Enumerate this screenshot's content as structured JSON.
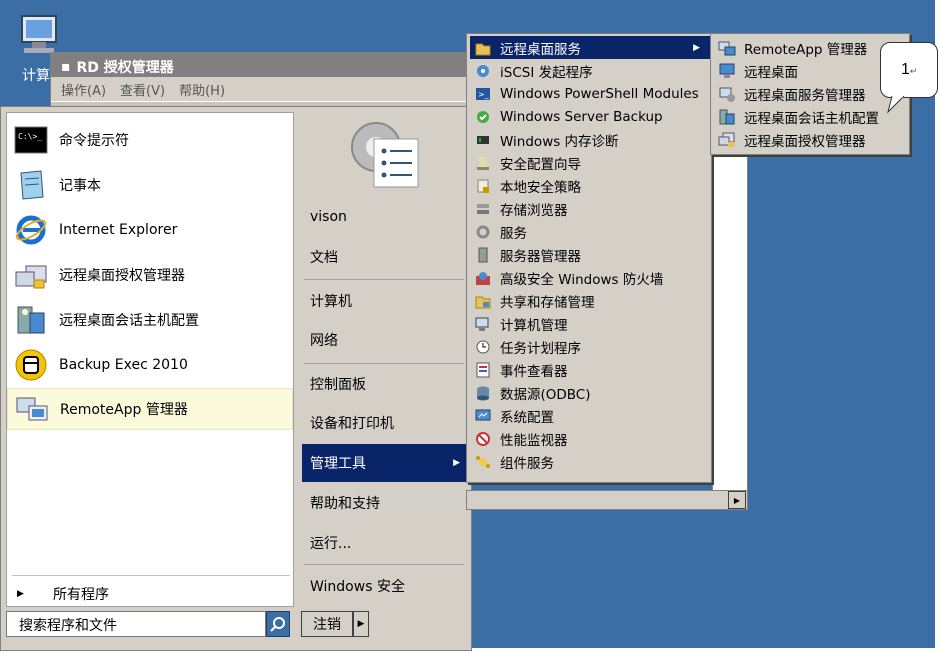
{
  "desktop": {
    "icon_label": "计算"
  },
  "background_window": {
    "title": "RD 授权管理器",
    "menu": [
      "操作(A)",
      "查看(V)",
      "帮助(H)"
    ]
  },
  "start_menu": {
    "pinned": [
      {
        "label": "命令提示符",
        "icon": "cmd-icon"
      },
      {
        "label": "记事本",
        "icon": "notepad-icon"
      },
      {
        "label": "Internet Explorer",
        "icon": "ie-icon"
      },
      {
        "label": "远程桌面授权管理器",
        "icon": "rd-license-icon"
      },
      {
        "label": "远程桌面会话主机配置",
        "icon": "rd-session-config-icon"
      },
      {
        "label": "Backup Exec 2010",
        "icon": "backup-exec-icon"
      },
      {
        "label": "RemoteApp 管理器",
        "icon": "remoteapp-icon"
      }
    ],
    "all_programs": "所有程序",
    "search_placeholder": "搜索程序和文件",
    "right": {
      "user": "vison",
      "items": [
        "文档",
        "计算机",
        "网络",
        "控制面板",
        "设备和打印机",
        "管理工具",
        "帮助和支持",
        "运行...",
        "Windows 安全"
      ]
    },
    "logout": "注销"
  },
  "admin_tools_menu": {
    "items": [
      {
        "label": "远程桌面服务",
        "has_submenu": true
      },
      {
        "label": "iSCSI 发起程序"
      },
      {
        "label": "Windows PowerShell Modules"
      },
      {
        "label": "Windows Server Backup"
      },
      {
        "label": "Windows 内存诊断"
      },
      {
        "label": "安全配置向导"
      },
      {
        "label": "本地安全策略"
      },
      {
        "label": "存储浏览器"
      },
      {
        "label": "服务"
      },
      {
        "label": "服务器管理器"
      },
      {
        "label": "高级安全 Windows 防火墙"
      },
      {
        "label": "共享和存储管理"
      },
      {
        "label": "计算机管理"
      },
      {
        "label": "任务计划程序"
      },
      {
        "label": "事件查看器"
      },
      {
        "label": "数据源(ODBC)"
      },
      {
        "label": "系统配置"
      },
      {
        "label": "性能监视器"
      },
      {
        "label": "组件服务"
      }
    ]
  },
  "rds_submenu": {
    "items": [
      "RemoteApp 管理器",
      "远程桌面",
      "远程桌面服务管理器",
      "远程桌面会话主机配置",
      "远程桌面授权管理器"
    ]
  },
  "callout": {
    "number": "1",
    "mark": "↵"
  },
  "colors": {
    "desktop": "#3a6ea5",
    "highlight": "#0a246a",
    "menu_bg": "#d4d0c8"
  }
}
